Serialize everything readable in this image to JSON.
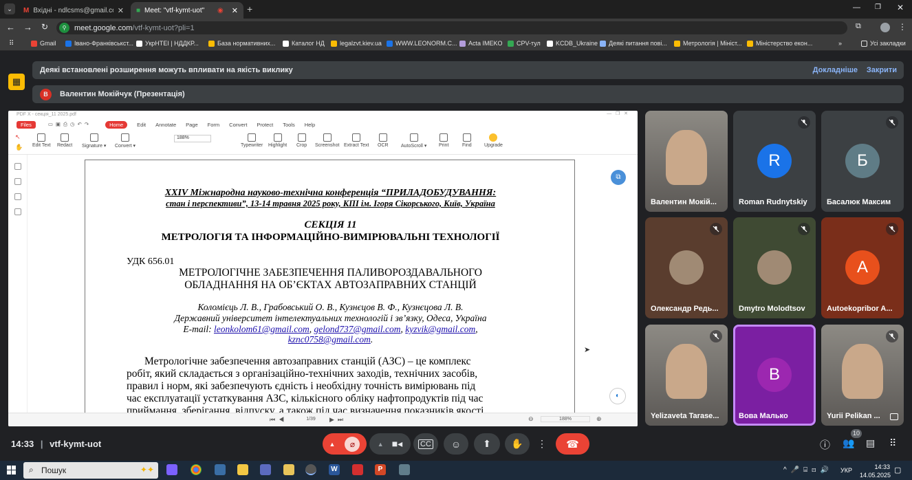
{
  "browser": {
    "tabs": [
      {
        "title": "Вхідні - ndlcsms@gmail.com - Gm",
        "active": false
      },
      {
        "title": "Meet: \"vtf-kymt-uot\"",
        "active": true
      }
    ],
    "url_host": "meet.google.com",
    "url_path": "/vtf-kymt-uot?pli=1",
    "bookmarks": [
      "Gmail",
      "Івано-Франківськст...",
      "УкрНТЕІ | НДДКР...",
      "База нормативних...",
      "Каталог НД",
      "legalzvt.kiev.ua",
      "WWW.LEONORM.C...",
      "Acta IMEKO",
      "CPV-тул",
      "KCDB_Ukraine",
      "Деякі питання пові...",
      "Метрологія | Мініст...",
      "Міністерство екон..."
    ],
    "bookmarks_more": "»",
    "all_bookmarks": "Усі закладки"
  },
  "meet": {
    "warning": "Деякі встановлені розширення можуть впливати на якість виклику",
    "warning_more": "Докладніше",
    "warning_close": "Закрити",
    "presenter_initial": "В",
    "presenter": "Валентин Мокійчук (Презентація)",
    "time": "14:33",
    "meeting_code": "vtf-kymt-uot",
    "participants_count": "10",
    "tiles": [
      {
        "name": "Валентин Мокій...",
        "type": "video",
        "muted": false
      },
      {
        "name": "Roman Rudnytskiy",
        "initial": "R",
        "color": "#1a73e8",
        "bg": "#3c4043",
        "muted": true
      },
      {
        "name": "Басалюк Максим",
        "initial": "Б",
        "color": "#5f7c86",
        "bg": "#3c4043",
        "muted": true
      },
      {
        "name": "Олександр Редь...",
        "type": "avatar-photo",
        "bg": "#5a3d2e",
        "muted": true
      },
      {
        "name": "Dmytro Molodtsov",
        "type": "avatar-photo",
        "bg": "#3f4a33",
        "muted": true
      },
      {
        "name": "Autoekopribor A...",
        "initial": "A",
        "color": "#e8501c",
        "bg": "#7a2e1a",
        "muted": true
      },
      {
        "name": "Yelizaveta Tarase...",
        "type": "video",
        "muted": true
      },
      {
        "name": "Вова Малько",
        "initial": "В",
        "color": "#9c27b0",
        "bg": "#7b1fa2",
        "muted": false,
        "speaking": true
      },
      {
        "name": "Yurii Pelikan ...",
        "type": "video",
        "muted": true
      }
    ]
  },
  "pdf": {
    "window_title": "PDF X - секція_11 2025.pdf",
    "menu": [
      "Files",
      "Home",
      "Edit",
      "Annotate",
      "Page",
      "Form",
      "Convert",
      "Protect",
      "Tools",
      "Help"
    ],
    "tools": [
      "Edit Text",
      "Redact",
      "Signature ▾",
      "Convert ▾",
      "Typewriter",
      "Highlight",
      "Crop",
      "Screenshot",
      "Extract Text",
      "OCR",
      "AutoScroll ▾",
      "Print",
      "Find",
      "Upgrade"
    ],
    "zoom_top": "188%",
    "page_indicator": "1/39",
    "zoom_bottom": "188%",
    "conf_line1": "XXIV Міжнародна науково-технічна конференція “ПРИЛАДОБУДУВАННЯ:",
    "conf_line2": "стан і перспективи”, 13-14 травня 2025 року, КПІ ім. Ігоря Сікорського, Київ, Україна",
    "section": "СЕКЦІЯ 11",
    "section_title": "МЕТРОЛОГІЯ ТА ІНФОРМАЦІЙНО-ВИМІРЮВАЛЬНІ ТЕХНОЛОГІЇ",
    "udc": "УДК 656.01",
    "title1": "МЕТРОЛОГІЧНЕ ЗАБЕЗПЕЧЕННЯ ПАЛИВОРОЗДАВАЛЬНОГО",
    "title2": "ОБЛАДНАННЯ НА ОБ’ЄКТАХ АВТОЗАПРАВНИХ СТАНЦІЙ",
    "authors": "Коломієць Л. В., Грабовський О. В., Кузнєцов В. Ф., Кузнєцова Л. В.",
    "affiliation": "Державний університет інтелектуальних технологій і зв’язку, Одеса, Україна",
    "email_label": "E-mail:",
    "email1": "leonkolom61@gmail.com",
    "email2": "gelond737@gmail.com",
    "email3": "kyzvik@gmail.com",
    "email4": "kznc0758@gmail.com",
    "body": [
      "Метрологічне забезпечення автозаправних станцій (АЗС) – це комплекс",
      "робіт, який складається з організаційно-технічних заходів, технічних засобів,",
      "правил і норм, які забезпечують єдність і необхідну точність вимірювань під",
      "час експлуатації устаткування АЗС, кількісного обліку нафтопродуктів під час",
      "приймання, зберігання, відпуску, а також під час визначення показників якості."
    ]
  },
  "taskbar": {
    "search": "Пошук",
    "lang": "УКР",
    "time": "14:33",
    "date": "14.05.2025"
  },
  "colors": {
    "end_call": "#ea4335",
    "mic_off": "#ea4335",
    "accent_link": "#8ab4f8"
  }
}
